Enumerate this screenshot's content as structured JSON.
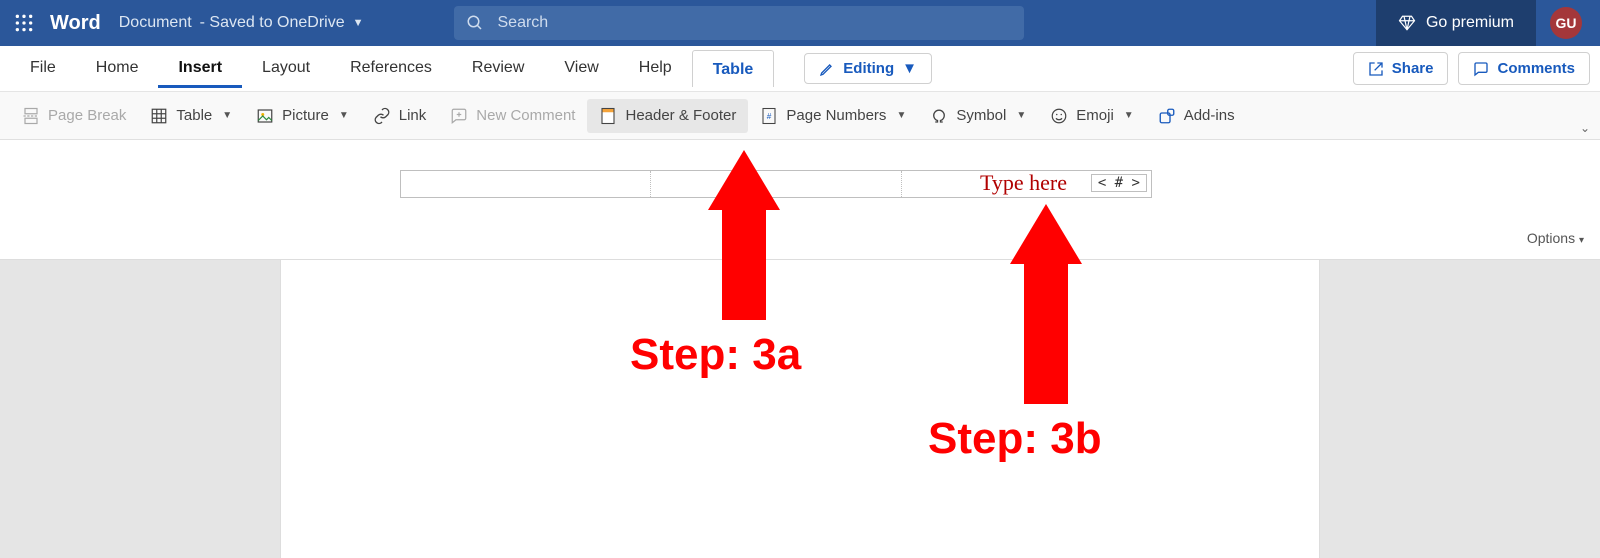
{
  "titlebar": {
    "app_name": "Word",
    "doc_label_a": "Document",
    "doc_label_b": "- Saved to OneDrive",
    "search_placeholder": "Search",
    "premium_label": "Go premium",
    "avatar_initials": "GU"
  },
  "tabs": {
    "file": "File",
    "home": "Home",
    "insert": "Insert",
    "layout": "Layout",
    "references": "References",
    "review": "Review",
    "view": "View",
    "help": "Help",
    "table": "Table",
    "editing_label": "Editing",
    "share_label": "Share",
    "comments_label": "Comments"
  },
  "ribbon": {
    "page_break": "Page Break",
    "table": "Table",
    "picture": "Picture",
    "link": "Link",
    "new_comment": "New Comment",
    "header_footer": "Header & Footer",
    "page_numbers": "Page Numbers",
    "symbol": "Symbol",
    "emoji": "Emoji",
    "addins": "Add-ins"
  },
  "header_area": {
    "type_here_hint": "Type here",
    "page_num_placeholder": "< # >",
    "options_label": "Options"
  },
  "annotations": {
    "step_a": "Step: 3a",
    "step_b": "Step: 3b"
  }
}
